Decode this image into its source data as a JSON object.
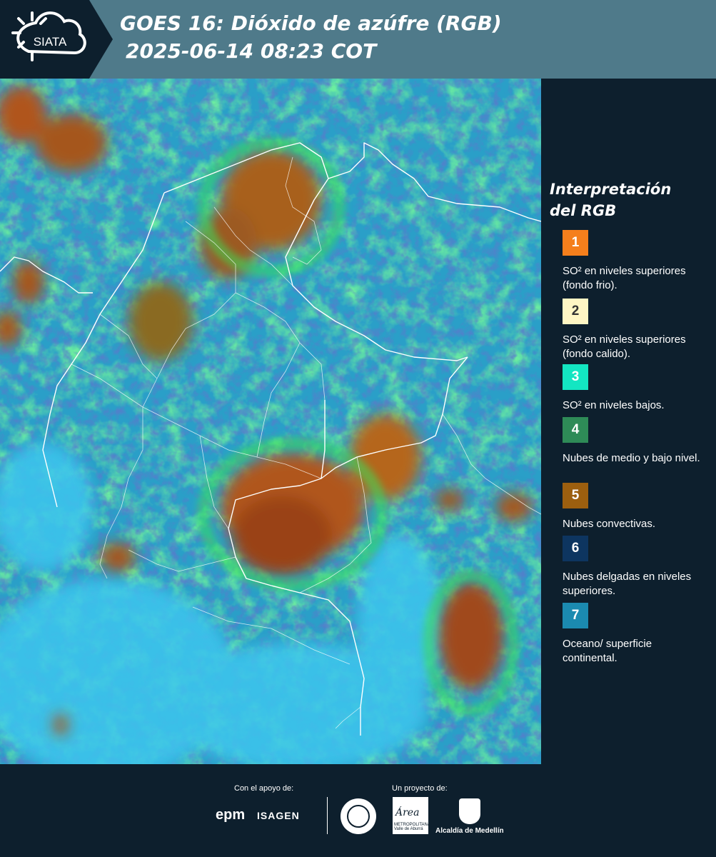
{
  "header": {
    "logo_text": "SIATA",
    "title_line1": "GOES 16: Dióxido de azúfre (RGB)",
    "title_line2": "2025-06-14 08:23 COT"
  },
  "legend": {
    "title": "Interpretación del RGB",
    "items": [
      {
        "number": "1",
        "color": "#f57f1c",
        "label": "SO² en niveles superiores (fondo frio)."
      },
      {
        "number": "2",
        "color": "#fff6c4",
        "label": "SO² en niveles superiores (fondo calido)."
      },
      {
        "number": "3",
        "color": "#13e6c2",
        "label": "SO² en niveles bajos."
      },
      {
        "number": "4",
        "color": "#2e8b57",
        "label": "Nubes de medio y bajo nivel."
      },
      {
        "number": "5",
        "color": "#9c5f0f",
        "label": "Nubes convectivas."
      },
      {
        "number": "6",
        "color": "#0d3560",
        "label": "Nubes delgadas en niveles superiores."
      },
      {
        "number": "7",
        "color": "#1b8ab0",
        "label": "Oceano/ superficie continental."
      }
    ]
  },
  "footer": {
    "support_label": "Con el apoyo de:",
    "project_label": "Un proyecto de:",
    "sponsor_epm": "epm",
    "sponsor_isagen": "ISAGEN",
    "amva_logo": "Área",
    "amva_sub": "METROPOLITANA Valle de Aburrá",
    "alcaldia": "Alcaldía de Medellín"
  },
  "colors": {
    "header_bg": "#4f7a8a",
    "page_bg": "#0d1f2d",
    "ocean": "#39b8de",
    "cloud_green": "#2fd05a",
    "convective": "#a65a1e",
    "thin_cloud": "#1b2f8a"
  }
}
